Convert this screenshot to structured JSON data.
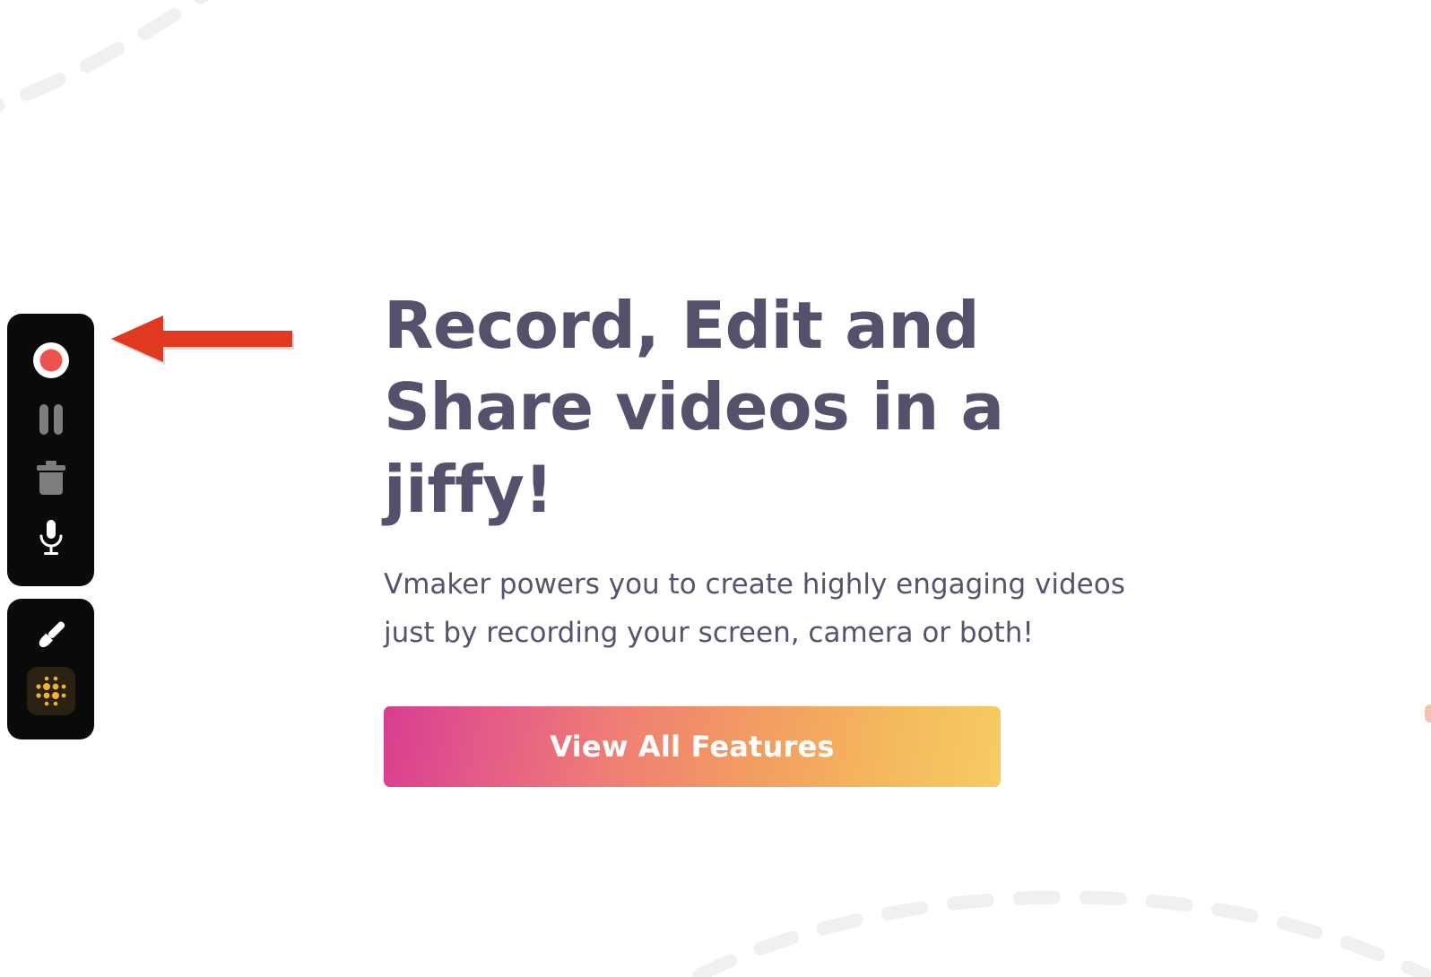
{
  "page": {
    "background_color": "#ffffff",
    "accent_headline_color": "#53516b",
    "annotation_arrow_color": "#e0391f"
  },
  "recorder_toolbar": {
    "name": "vmaker-screen-recorder-toolbar",
    "panel_background": "#0a0a0a",
    "panels": [
      {
        "name": "recording-controls",
        "buttons": [
          {
            "name": "record-button",
            "icon": "record-icon",
            "label": "Record",
            "color": "#ef5350",
            "ring_color": "#ffffff"
          },
          {
            "name": "pause-button",
            "icon": "pause-icon",
            "label": "Pause",
            "color": "#7d7d7d"
          },
          {
            "name": "delete-button",
            "icon": "trash-icon",
            "label": "Delete",
            "color": "#7d7d7d"
          },
          {
            "name": "microphone-button",
            "icon": "microphone-icon",
            "label": "Microphone",
            "color": "#ffffff"
          }
        ]
      },
      {
        "name": "annotation-tools",
        "buttons": [
          {
            "name": "brush-button",
            "icon": "paint-brush-icon",
            "label": "Draw",
            "color": "#ffffff"
          },
          {
            "name": "spotlight-button",
            "icon": "dot-grid-icon",
            "label": "Spotlight",
            "color": "#f2b32c",
            "tile_background": "#2a2112"
          }
        ]
      }
    ]
  },
  "annotation": {
    "arrow": {
      "name": "pointer-arrow",
      "direction": "left",
      "color": "#e0391f",
      "points_to": "record-button"
    }
  },
  "hero": {
    "headline": "Record, Edit and Share videos in a jiffy!",
    "subtitle": "Vmaker powers you to create highly engaging videos just by recording your screen, camera or both!",
    "cta_label": "View All Features",
    "cta_gradient_from": "#d83d8f",
    "cta_gradient_to": "#f6cd63"
  },
  "decorations": {
    "top_left_dashed_arc": "dashed-arc",
    "bottom_right_dashed_arc": "dashed-arc",
    "right_edge_sliver_color": "#f3b99d",
    "dash_color": "#f0f0f1"
  }
}
